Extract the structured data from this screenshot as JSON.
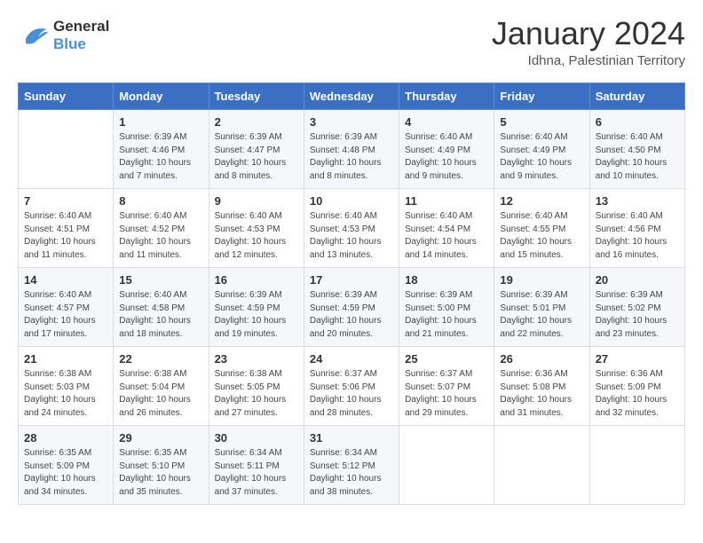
{
  "logo": {
    "line1": "General",
    "line2": "Blue"
  },
  "title": "January 2024",
  "subtitle": "Idhna, Palestinian Territory",
  "headers": [
    "Sunday",
    "Monday",
    "Tuesday",
    "Wednesday",
    "Thursday",
    "Friday",
    "Saturday"
  ],
  "weeks": [
    [
      {
        "day": "",
        "sunrise": "",
        "sunset": "",
        "daylight": ""
      },
      {
        "day": "1",
        "sunrise": "Sunrise: 6:39 AM",
        "sunset": "Sunset: 4:46 PM",
        "daylight": "Daylight: 10 hours and 7 minutes."
      },
      {
        "day": "2",
        "sunrise": "Sunrise: 6:39 AM",
        "sunset": "Sunset: 4:47 PM",
        "daylight": "Daylight: 10 hours and 8 minutes."
      },
      {
        "day": "3",
        "sunrise": "Sunrise: 6:39 AM",
        "sunset": "Sunset: 4:48 PM",
        "daylight": "Daylight: 10 hours and 8 minutes."
      },
      {
        "day": "4",
        "sunrise": "Sunrise: 6:40 AM",
        "sunset": "Sunset: 4:49 PM",
        "daylight": "Daylight: 10 hours and 9 minutes."
      },
      {
        "day": "5",
        "sunrise": "Sunrise: 6:40 AM",
        "sunset": "Sunset: 4:49 PM",
        "daylight": "Daylight: 10 hours and 9 minutes."
      },
      {
        "day": "6",
        "sunrise": "Sunrise: 6:40 AM",
        "sunset": "Sunset: 4:50 PM",
        "daylight": "Daylight: 10 hours and 10 minutes."
      }
    ],
    [
      {
        "day": "7",
        "sunrise": "Sunrise: 6:40 AM",
        "sunset": "Sunset: 4:51 PM",
        "daylight": "Daylight: 10 hours and 11 minutes."
      },
      {
        "day": "8",
        "sunrise": "Sunrise: 6:40 AM",
        "sunset": "Sunset: 4:52 PM",
        "daylight": "Daylight: 10 hours and 11 minutes."
      },
      {
        "day": "9",
        "sunrise": "Sunrise: 6:40 AM",
        "sunset": "Sunset: 4:53 PM",
        "daylight": "Daylight: 10 hours and 12 minutes."
      },
      {
        "day": "10",
        "sunrise": "Sunrise: 6:40 AM",
        "sunset": "Sunset: 4:53 PM",
        "daylight": "Daylight: 10 hours and 13 minutes."
      },
      {
        "day": "11",
        "sunrise": "Sunrise: 6:40 AM",
        "sunset": "Sunset: 4:54 PM",
        "daylight": "Daylight: 10 hours and 14 minutes."
      },
      {
        "day": "12",
        "sunrise": "Sunrise: 6:40 AM",
        "sunset": "Sunset: 4:55 PM",
        "daylight": "Daylight: 10 hours and 15 minutes."
      },
      {
        "day": "13",
        "sunrise": "Sunrise: 6:40 AM",
        "sunset": "Sunset: 4:56 PM",
        "daylight": "Daylight: 10 hours and 16 minutes."
      }
    ],
    [
      {
        "day": "14",
        "sunrise": "Sunrise: 6:40 AM",
        "sunset": "Sunset: 4:57 PM",
        "daylight": "Daylight: 10 hours and 17 minutes."
      },
      {
        "day": "15",
        "sunrise": "Sunrise: 6:40 AM",
        "sunset": "Sunset: 4:58 PM",
        "daylight": "Daylight: 10 hours and 18 minutes."
      },
      {
        "day": "16",
        "sunrise": "Sunrise: 6:39 AM",
        "sunset": "Sunset: 4:59 PM",
        "daylight": "Daylight: 10 hours and 19 minutes."
      },
      {
        "day": "17",
        "sunrise": "Sunrise: 6:39 AM",
        "sunset": "Sunset: 4:59 PM",
        "daylight": "Daylight: 10 hours and 20 minutes."
      },
      {
        "day": "18",
        "sunrise": "Sunrise: 6:39 AM",
        "sunset": "Sunset: 5:00 PM",
        "daylight": "Daylight: 10 hours and 21 minutes."
      },
      {
        "day": "19",
        "sunrise": "Sunrise: 6:39 AM",
        "sunset": "Sunset: 5:01 PM",
        "daylight": "Daylight: 10 hours and 22 minutes."
      },
      {
        "day": "20",
        "sunrise": "Sunrise: 6:39 AM",
        "sunset": "Sunset: 5:02 PM",
        "daylight": "Daylight: 10 hours and 23 minutes."
      }
    ],
    [
      {
        "day": "21",
        "sunrise": "Sunrise: 6:38 AM",
        "sunset": "Sunset: 5:03 PM",
        "daylight": "Daylight: 10 hours and 24 minutes."
      },
      {
        "day": "22",
        "sunrise": "Sunrise: 6:38 AM",
        "sunset": "Sunset: 5:04 PM",
        "daylight": "Daylight: 10 hours and 26 minutes."
      },
      {
        "day": "23",
        "sunrise": "Sunrise: 6:38 AM",
        "sunset": "Sunset: 5:05 PM",
        "daylight": "Daylight: 10 hours and 27 minutes."
      },
      {
        "day": "24",
        "sunrise": "Sunrise: 6:37 AM",
        "sunset": "Sunset: 5:06 PM",
        "daylight": "Daylight: 10 hours and 28 minutes."
      },
      {
        "day": "25",
        "sunrise": "Sunrise: 6:37 AM",
        "sunset": "Sunset: 5:07 PM",
        "daylight": "Daylight: 10 hours and 29 minutes."
      },
      {
        "day": "26",
        "sunrise": "Sunrise: 6:36 AM",
        "sunset": "Sunset: 5:08 PM",
        "daylight": "Daylight: 10 hours and 31 minutes."
      },
      {
        "day": "27",
        "sunrise": "Sunrise: 6:36 AM",
        "sunset": "Sunset: 5:09 PM",
        "daylight": "Daylight: 10 hours and 32 minutes."
      }
    ],
    [
      {
        "day": "28",
        "sunrise": "Sunrise: 6:35 AM",
        "sunset": "Sunset: 5:09 PM",
        "daylight": "Daylight: 10 hours and 34 minutes."
      },
      {
        "day": "29",
        "sunrise": "Sunrise: 6:35 AM",
        "sunset": "Sunset: 5:10 PM",
        "daylight": "Daylight: 10 hours and 35 minutes."
      },
      {
        "day": "30",
        "sunrise": "Sunrise: 6:34 AM",
        "sunset": "Sunset: 5:11 PM",
        "daylight": "Daylight: 10 hours and 37 minutes."
      },
      {
        "day": "31",
        "sunrise": "Sunrise: 6:34 AM",
        "sunset": "Sunset: 5:12 PM",
        "daylight": "Daylight: 10 hours and 38 minutes."
      },
      {
        "day": "",
        "sunrise": "",
        "sunset": "",
        "daylight": ""
      },
      {
        "day": "",
        "sunrise": "",
        "sunset": "",
        "daylight": ""
      },
      {
        "day": "",
        "sunrise": "",
        "sunset": "",
        "daylight": ""
      }
    ]
  ]
}
